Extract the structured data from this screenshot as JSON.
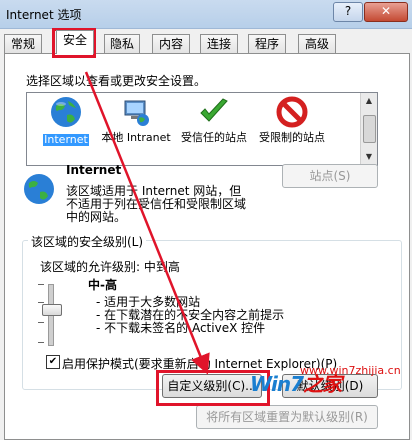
{
  "window": {
    "title": "Internet 选项",
    "help": "?",
    "close": "✕"
  },
  "tabs": [
    "常规",
    "安全",
    "隐私",
    "内容",
    "连接",
    "程序",
    "高级"
  ],
  "active_tab": "安全",
  "instruction": "选择区域以查看或更改安全设置。",
  "zones": [
    {
      "label": "Internet",
      "icon": "globe-icon"
    },
    {
      "label": "本地 Intranet",
      "icon": "computer-network-icon"
    },
    {
      "label": "受信任的站点",
      "icon": "check-icon"
    },
    {
      "label": "受限制的站点",
      "icon": "prohibited-icon"
    }
  ],
  "zone_info": {
    "heading": "Internet",
    "description": [
      "该区域适用于 Internet 网站，但",
      "不适用于列在受信任和受限制区域",
      "中的网站。"
    ],
    "sites_button": "站点(S)"
  },
  "security_level": {
    "group_title": "该区域的安全级别(L)",
    "allowed_level": "该区域的允许级别: 中到高",
    "current_level": "中-高",
    "bullets": [
      "- 适用于大多数网站",
      "- 在下载潜在的不安全内容之前提示",
      "- 不下载未签名的 ActiveX 控件"
    ]
  },
  "protected_mode": {
    "label": "启用保护模式(要求重新启动 Internet Explorer)(P)",
    "checked": true
  },
  "buttons": {
    "custom_level": "自定义级别(C)...",
    "default_level": "默认级别(D)",
    "reset_all": "将所有区域重置为默认级别(R)"
  },
  "watermark": {
    "text": "Win7",
    "url": "www.win7zhijia.cn",
    "suffix": "之家"
  },
  "colors": {
    "highlight_red": "#e0142a",
    "selection_blue": "#3399ff"
  }
}
